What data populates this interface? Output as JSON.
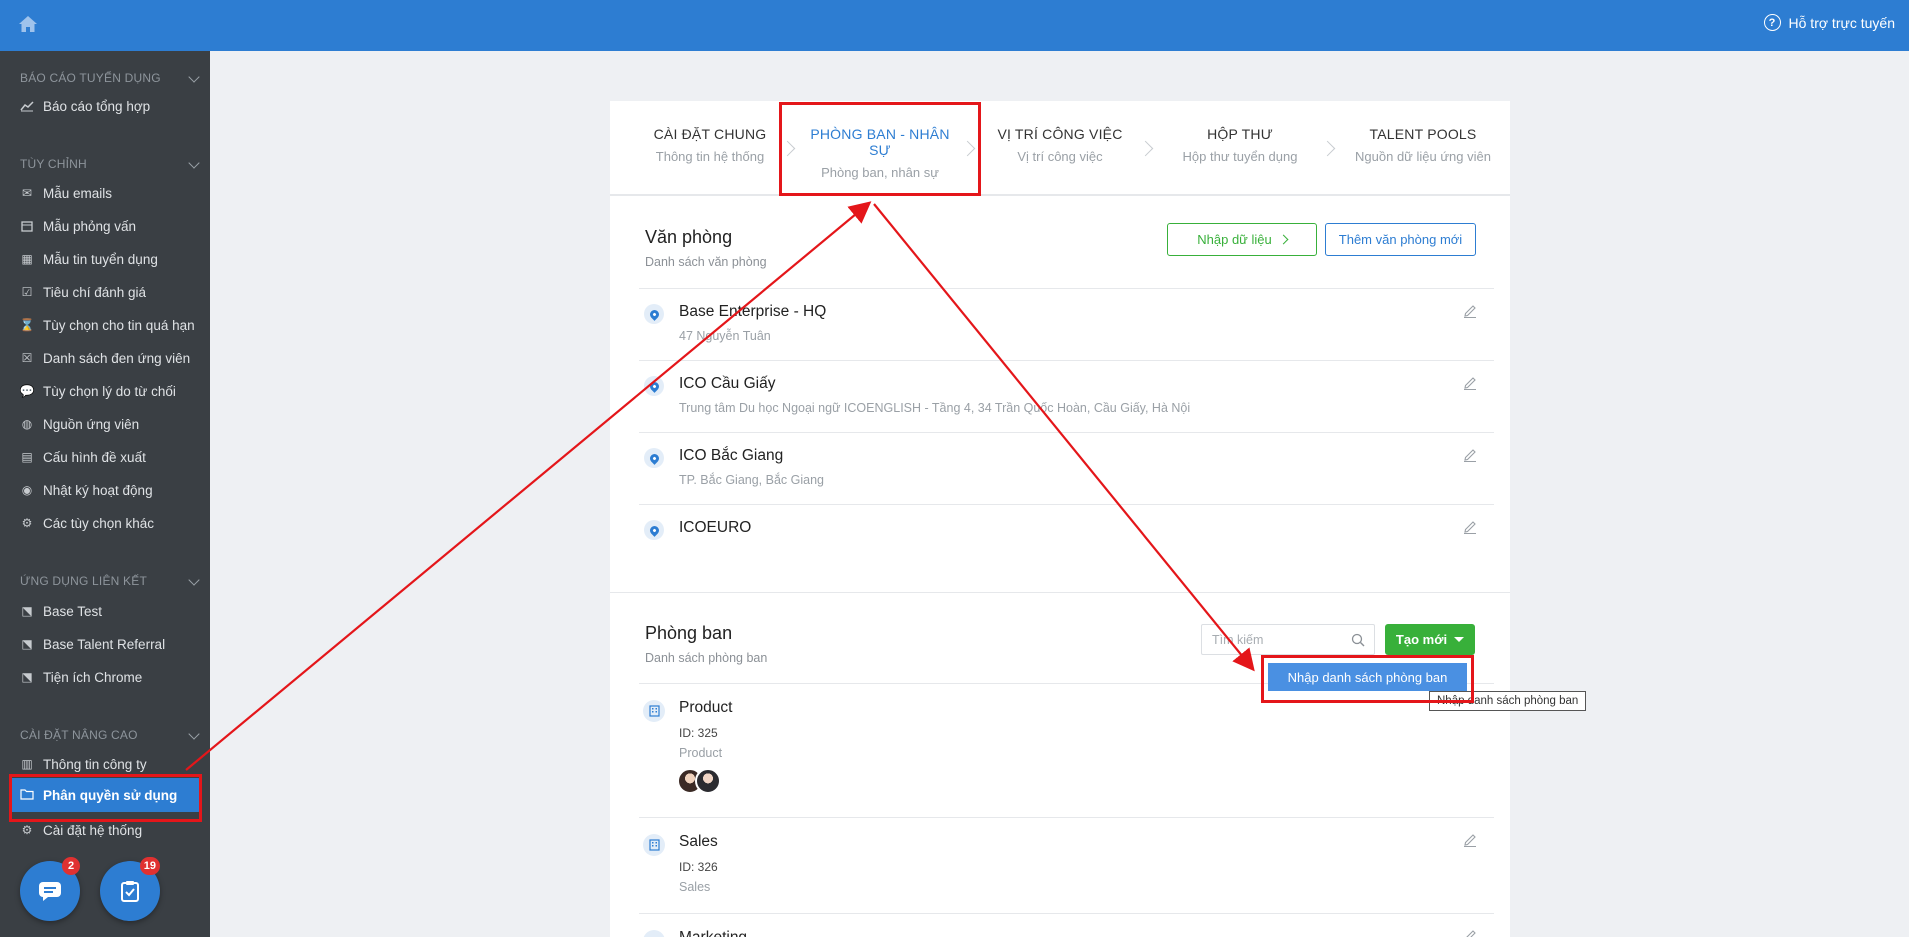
{
  "topbar": {
    "help_label": "Hỗ trợ trực tuyến",
    "help_glyph": "?",
    "color": "#2d7dd2"
  },
  "sidebar": {
    "sections": [
      {
        "title": "BÁO CÁO TUYỂN DỤNG",
        "items": [
          "Báo cáo tổng hợp"
        ]
      },
      {
        "title": "TÙY CHỈNH",
        "items": [
          "Mẫu emails",
          "Mẫu phỏng vấn",
          "Mẫu tin tuyển dụng",
          "Tiêu chí đánh giá",
          "Tùy chọn cho tin quá hạn",
          "Danh sách đen ứng viên",
          "Tùy chọn lý do từ chối",
          "Nguồn ứng viên",
          "Cấu hình đề xuất",
          "Nhật ký hoạt động",
          "Các tùy chọn khác"
        ]
      },
      {
        "title": "ỨNG DỤNG LIÊN KẾT",
        "items": [
          "Base Test",
          "Base Talent Referral",
          "Tiện ích Chrome"
        ]
      },
      {
        "title": "CÀI ĐẶT NÂNG CAO",
        "items": [
          "Thông tin công ty",
          "Phân quyền sử dụng",
          "Cài đặt hệ thống"
        ]
      }
    ],
    "active_item": "Phân quyền sử dụng",
    "fab_chat_badge": "2",
    "fab_task_badge": "19"
  },
  "steps": [
    {
      "title": "CÀI ĐẶT CHUNG",
      "sub": "Thông tin hệ thống"
    },
    {
      "title": "PHÒNG BAN - NHÂN SỰ",
      "sub": "Phòng ban, nhân sự"
    },
    {
      "title": "VỊ TRÍ CÔNG VIỆC",
      "sub": "Vị trí công việc"
    },
    {
      "title": "HỘP THƯ",
      "sub": "Hộp thư tuyển dụng"
    },
    {
      "title": "TALENT POOLS",
      "sub": "Nguồn dữ liệu ứng viên"
    }
  ],
  "offices": {
    "title": "Văn phòng",
    "subtitle": "Danh sách văn phòng",
    "import_label": "Nhập dữ liệu",
    "add_label": "Thêm văn phòng mới",
    "items": [
      {
        "name": "Base Enterprise - HQ",
        "address": "47 Nguyễn Tuân"
      },
      {
        "name": "ICO Cầu Giấy",
        "address": "Trung tâm Du học Ngoại ngữ ICOENGLISH - Tầng 4, 34 Trần Quốc Hoàn, Cầu Giấy, Hà Nội"
      },
      {
        "name": "ICO Bắc Giang",
        "address": "TP. Bắc Giang, Bắc Giang"
      },
      {
        "name": "ICOEURO",
        "address": ""
      }
    ]
  },
  "departments": {
    "title": "Phòng ban",
    "subtitle": "Danh sách phòng ban",
    "search_placeholder": "Tìm kiếm",
    "create_label": "Tạo mới",
    "dropdown_item": "Nhập danh sách phòng ban",
    "tooltip": "Nhập danh sách phòng ban",
    "items": [
      {
        "name": "Product",
        "id": "ID: 325",
        "sub": "Product"
      },
      {
        "name": "Sales",
        "id": "ID: 326",
        "sub": "Sales"
      },
      {
        "name": "Marketing",
        "id": "",
        "sub": ""
      }
    ]
  },
  "colors": {
    "accent": "#2d7dd2",
    "green": "#38b03a",
    "annotation_red": "#e4161a",
    "sidebar_bg": "#3a3f44"
  }
}
